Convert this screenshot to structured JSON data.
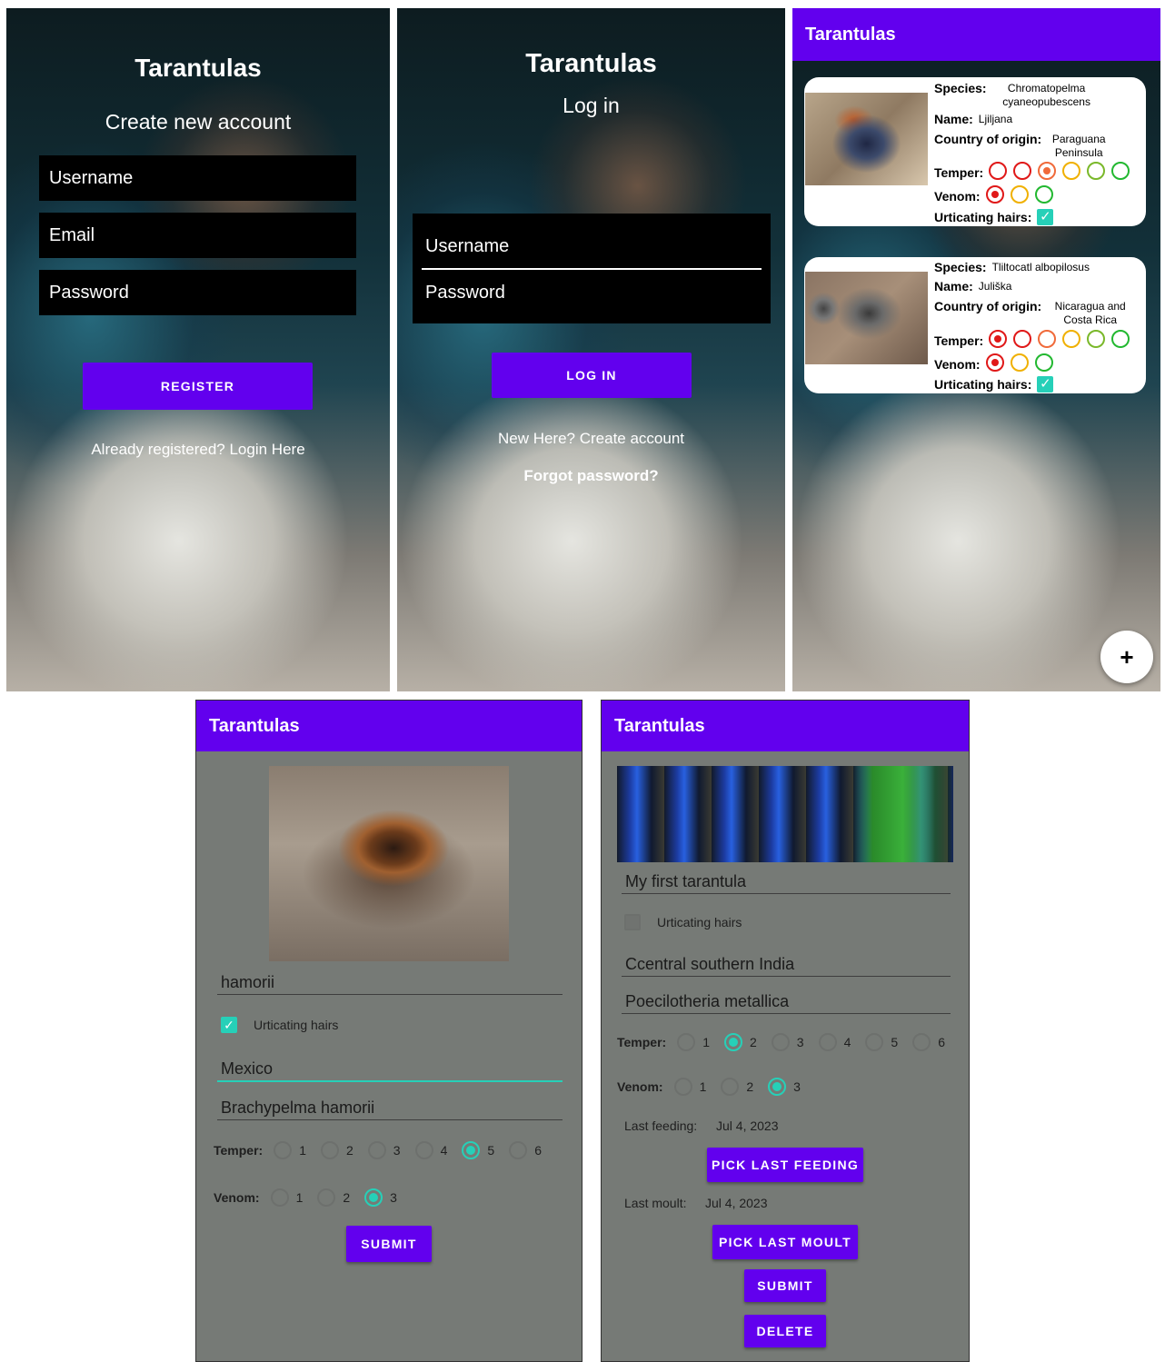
{
  "register_screen": {
    "title": "Tarantulas",
    "subtitle": "Create new account",
    "username_placeholder": "Username",
    "email_placeholder": "Email",
    "password_placeholder": "Password",
    "register_label": "REGISTER",
    "login_link": "Already registered? Login Here"
  },
  "login_screen": {
    "title": "Tarantulas",
    "subtitle": "Log in",
    "username_placeholder": "Username",
    "password_placeholder": "Password",
    "login_label": "LOG IN",
    "create_link": "New Here? Create account",
    "forgot_link": "Forgot password?"
  },
  "list_screen": {
    "app_bar_title": "Tarantulas",
    "labels": {
      "species": "Species:",
      "name": "Name:",
      "country": "Country of origin:",
      "temper": "Temper:",
      "venom": "Venom:",
      "urticating": "Urticating hairs:"
    },
    "cards": [
      {
        "species": "Chromatopelma cyaneopubescens",
        "name": "Ljiljana",
        "country": "Paraguana Peninsula",
        "temper_level": 3,
        "venom_level": 1,
        "urticating_hairs": true
      },
      {
        "species": "Tliltocatl albopilosus",
        "name": "Juliška",
        "country": "Nicaragua and Costa Rica",
        "temper_level": 1,
        "venom_level": 1,
        "urticating_hairs": true
      }
    ],
    "temper_colors": [
      "#e01818",
      "#e01818",
      "#f06a3a",
      "#f0b000",
      "#7ab82a",
      "#22b830"
    ],
    "venom_colors": [
      "#e01818",
      "#f0b000",
      "#22b830"
    ],
    "fab_icon": "plus-icon",
    "fab_glyph": "+"
  },
  "add_screen": {
    "app_bar_title": "Tarantulas",
    "name_value": "hamorii",
    "urticating_label": "Urticating hairs",
    "urticating_checked": true,
    "country_value": "Mexico",
    "species_value": "Brachypelma hamorii",
    "temper_label": "Temper:",
    "temper_options": [
      "1",
      "2",
      "3",
      "4",
      "5",
      "6"
    ],
    "temper_selected": "5",
    "venom_label": "Venom:",
    "venom_options": [
      "1",
      "2",
      "3"
    ],
    "venom_selected": "3",
    "submit_label": "SUBMIT"
  },
  "edit_screen": {
    "app_bar_title": "Tarantulas",
    "name_value": "My first tarantula",
    "urticating_label": "Urticating hairs",
    "urticating_checked": false,
    "country_value": "Ccentral southern India",
    "species_value": "Poecilotheria metallica",
    "temper_label": "Temper:",
    "temper_options": [
      "1",
      "2",
      "3",
      "4",
      "5",
      "6"
    ],
    "temper_selected": "2",
    "venom_label": "Venom:",
    "venom_options": [
      "1",
      "2",
      "3"
    ],
    "venom_selected": "3",
    "last_feeding_label": "Last feeding:",
    "last_feeding_value": "Jul 4, 2023",
    "pick_feeding_label": "PICK LAST FEEDING",
    "last_moult_label": "Last moult:",
    "last_moult_value": "Jul 4, 2023",
    "pick_moult_label": "PICK LAST MOULT",
    "submit_label": "SUBMIT",
    "delete_label": "DELETE"
  },
  "colors": {
    "primary": "#6200ee",
    "accent": "#26d0b8",
    "form_background": "#767a76"
  }
}
